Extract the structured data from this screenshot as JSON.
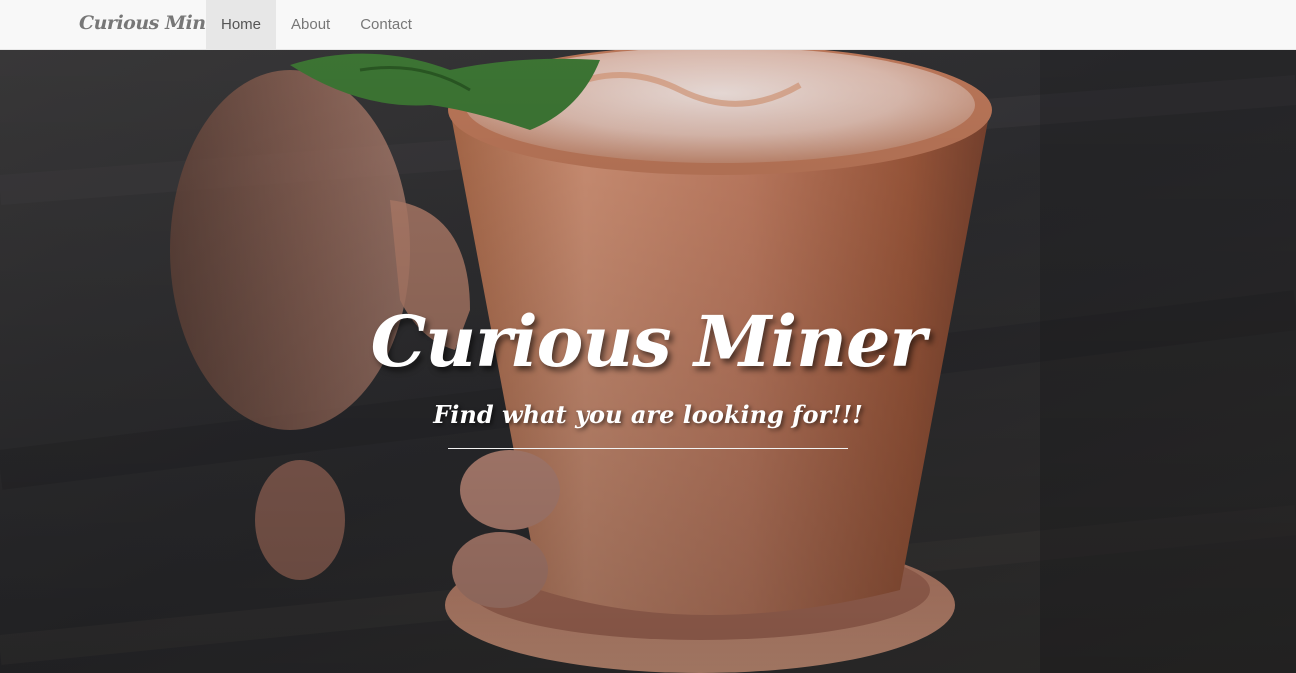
{
  "navbar": {
    "brand": "Curious Miner",
    "items": [
      {
        "label": "Home",
        "active": true
      },
      {
        "label": "About",
        "active": false
      },
      {
        "label": "Contact",
        "active": false
      }
    ]
  },
  "hero": {
    "title": "Curious Miner",
    "subtitle": "Find what you are looking for!!!"
  },
  "colors": {
    "navbar_bg": "#f8f8f8",
    "nav_text": "#777777",
    "nav_active_bg": "#e7e7e7",
    "hero_text": "#ffffff"
  }
}
